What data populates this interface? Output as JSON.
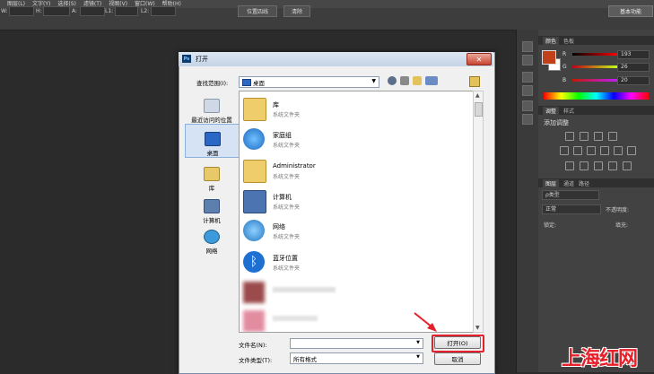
{
  "menu": [
    "图层(L)",
    "文字(Y)",
    "选择(S)",
    "滤镜(T)",
    "视图(V)",
    "窗口(W)",
    "帮助(H)"
  ],
  "options": {
    "w_label": "W:",
    "h_label": "H:",
    "a_label": "A:",
    "l1_label": "L1:",
    "l2_label": "L2:",
    "position_button": "位置四线",
    "clear_button": "清除",
    "workspace": "基本功能"
  },
  "color_panel": {
    "tabs": [
      "颜色",
      "色板"
    ],
    "r_label": "R",
    "r_value": "193",
    "g_label": "G",
    "g_value": "26",
    "b_label": "B",
    "b_value": "20",
    "foreground_color": "#c1411a"
  },
  "adjust_panel": {
    "tabs": [
      "调整",
      "样式"
    ],
    "title": "添加调整"
  },
  "layers_panel": {
    "tabs": [
      "图层",
      "通道",
      "路径"
    ],
    "kind": "ρ类型",
    "blend": "正常",
    "opacity": "不透明度:",
    "lock": "锁定:",
    "fill": "填充:"
  },
  "dialog": {
    "title": "打开",
    "ps_icon": "Ps",
    "lookin_label": "查找范围(I):",
    "lookin_value": "桌面",
    "places": [
      {
        "label": "最近访问的位置",
        "icon": "recent-places-icon"
      },
      {
        "label": "桌面",
        "icon": "desktop-icon"
      },
      {
        "label": "库",
        "icon": "libraries-icon"
      },
      {
        "label": "计算机",
        "icon": "computer-icon"
      },
      {
        "label": "网络",
        "icon": "network-icon"
      }
    ],
    "items": [
      {
        "name": "库",
        "sub": "系统文件夹",
        "icon": "libraries-folder-icon"
      },
      {
        "name": "家庭组",
        "sub": "系统文件夹",
        "icon": "homegroup-icon"
      },
      {
        "name": "Administrator",
        "sub": "系统文件夹",
        "icon": "user-folder-icon"
      },
      {
        "name": "计算机",
        "sub": "系统文件夹",
        "icon": "computer-icon"
      },
      {
        "name": "网络",
        "sub": "系统文件夹",
        "icon": "network-icon"
      },
      {
        "name": "蓝牙位置",
        "sub": "系统文件夹",
        "icon": "bluetooth-icon"
      }
    ],
    "filename_label": "文件名(N):",
    "filename_value": "",
    "filetype_label": "文件类型(T):",
    "filetype_value": "所有格式",
    "open_button": "打开(O)",
    "cancel_button": "取消",
    "highlight_color": "#e3202b"
  },
  "watermark": "上海红网"
}
